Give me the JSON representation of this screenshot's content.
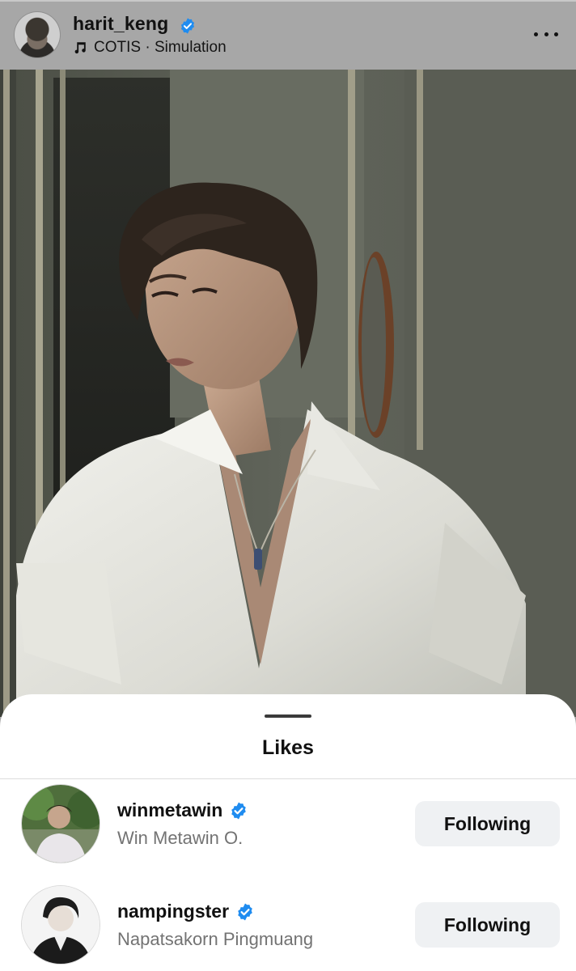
{
  "post": {
    "username": "harit_keng",
    "music": "COTIS · Simulation",
    "verified": true
  },
  "icons": {
    "verified": "verified-badge-icon",
    "music": "music-note-icon",
    "more": "more-options-icon"
  },
  "colors": {
    "verified_blue": "#1f8cf0",
    "button_bg": "#eff1f3",
    "secondary_text": "#737373"
  },
  "likes_sheet": {
    "title": "Likes",
    "users": [
      {
        "username": "winmetawin",
        "full_name": "Win Metawin O.",
        "verified": true,
        "button_label": "Following"
      },
      {
        "username": "nampingster",
        "full_name": "Napatsakorn Pingmuang",
        "verified": true,
        "button_label": "Following"
      }
    ]
  }
}
